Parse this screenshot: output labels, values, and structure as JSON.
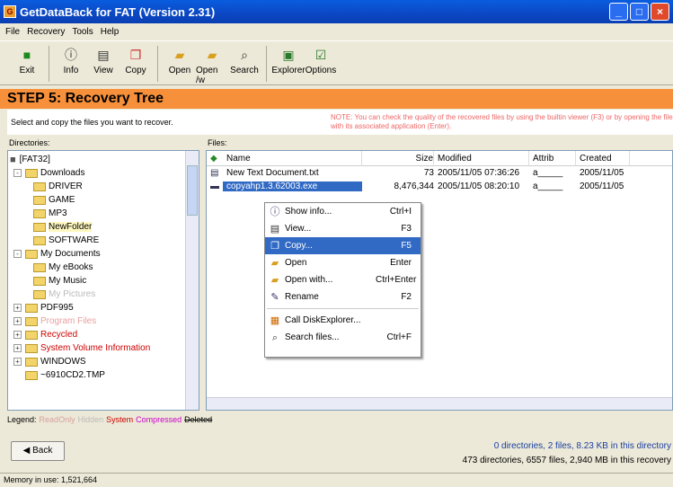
{
  "window": {
    "title": "GetDataBack for FAT (Version 2.31)"
  },
  "menu": [
    "File",
    "Recovery",
    "Tools",
    "Help"
  ],
  "toolbar": [
    {
      "label": "Exit",
      "icon": "exit-icon"
    },
    {
      "label": "Info",
      "icon": "info-icon"
    },
    {
      "label": "View",
      "icon": "view-icon"
    },
    {
      "label": "Copy",
      "icon": "copy-icon"
    },
    {
      "label": "Open",
      "icon": "open-icon"
    },
    {
      "label": "Open /w",
      "icon": "open-with-icon"
    },
    {
      "label": "Search",
      "icon": "search-icon"
    },
    {
      "label": "Explorer",
      "icon": "explorer-icon"
    },
    {
      "label": "Options",
      "icon": "options-icon"
    }
  ],
  "step": {
    "title": "STEP 5: Recovery Tree",
    "instruction": "Select and copy the files you want to recover.",
    "note": "NOTE: You can check the quality of the recovered files by using the builtin viewer (F3) or by opening the file with its associated application (Enter)."
  },
  "directories": {
    "header": "Directories:",
    "root": "[FAT32]",
    "items": [
      {
        "label": "Downloads",
        "level": 1,
        "expand": "-",
        "color": "#000"
      },
      {
        "label": "DRIVER",
        "level": 2,
        "expand": "",
        "color": "#000"
      },
      {
        "label": "GAME",
        "level": 2,
        "expand": "",
        "color": "#000"
      },
      {
        "label": "MP3",
        "level": 2,
        "expand": "",
        "color": "#000"
      },
      {
        "label": "NewFolder",
        "level": 2,
        "expand": "",
        "color": "#000"
      },
      {
        "label": "SOFTWARE",
        "level": 2,
        "expand": "",
        "color": "#000"
      },
      {
        "label": "My Documents",
        "level": 1,
        "expand": "-",
        "color": "#000"
      },
      {
        "label": "My eBooks",
        "level": 2,
        "expand": "",
        "color": "#000"
      },
      {
        "label": "My Music",
        "level": 2,
        "expand": "",
        "color": "#000"
      },
      {
        "label": "My Pictures",
        "level": 2,
        "expand": "",
        "color": "#bbb"
      },
      {
        "label": "PDF995",
        "level": 1,
        "expand": "+",
        "color": "#000"
      },
      {
        "label": "Program Files",
        "level": 1,
        "expand": "+",
        "color": "#e8a0a0"
      },
      {
        "label": "Recycled",
        "level": 1,
        "expand": "+",
        "color": "#c00"
      },
      {
        "label": "System Volume Information",
        "level": 1,
        "expand": "+",
        "color": "#c00"
      },
      {
        "label": "WINDOWS",
        "level": 1,
        "expand": "+",
        "color": "#000"
      },
      {
        "label": "~6910CD2.TMP",
        "level": 1,
        "expand": "",
        "color": "#000"
      }
    ]
  },
  "files": {
    "header": "Files:",
    "columns": [
      "Name",
      "Size",
      "Modified",
      "Attrib",
      "Created"
    ],
    "rows": [
      {
        "name": "New Text Document.txt",
        "size": "73",
        "modified": "2005/11/05 07:36:26",
        "attrib": "a_____",
        "created": "2005/11/05"
      },
      {
        "name": "copyahp1.3.62003.exe",
        "size": "8,476,344",
        "modified": "2005/11/05 08:20:10",
        "attrib": "a_____",
        "created": "2005/11/05"
      }
    ]
  },
  "context_menu": [
    {
      "label": "Show info...",
      "shortcut": "Ctrl+I",
      "icon": "info-icon"
    },
    {
      "label": "View...",
      "shortcut": "F3",
      "icon": "view-icon"
    },
    {
      "label": "Copy...",
      "shortcut": "F5",
      "icon": "copy-icon",
      "selected": true
    },
    {
      "label": "Open",
      "shortcut": "Enter",
      "icon": "open-icon"
    },
    {
      "label": "Open with...",
      "shortcut": "Ctrl+Enter",
      "icon": "open-with-icon"
    },
    {
      "label": "Rename",
      "shortcut": "F2",
      "icon": "rename-icon"
    },
    {
      "separator": true
    },
    {
      "label": "Call DiskExplorer...",
      "shortcut": "",
      "icon": "diskexplorer-icon"
    },
    {
      "label": "Search files...",
      "shortcut": "Ctrl+F",
      "icon": "search-icon"
    }
  ],
  "legend": {
    "label": "Legend:",
    "items": [
      {
        "text": "ReadOnly",
        "color": "#d8a0a0"
      },
      {
        "text": "Hidden",
        "color": "#bbb"
      },
      {
        "text": "System",
        "color": "#c00"
      },
      {
        "text": "Compressed",
        "color": "#c0c"
      },
      {
        "text": "Deleted",
        "color": "#000"
      }
    ]
  },
  "back_button": "Back",
  "summary": {
    "line1": "0 directories, 2 files, 8.23 KB in this directory",
    "line2": "473 directories, 6557 files, 2,940 MB in this recovery"
  },
  "status": "Memory in use: 1,521,664"
}
